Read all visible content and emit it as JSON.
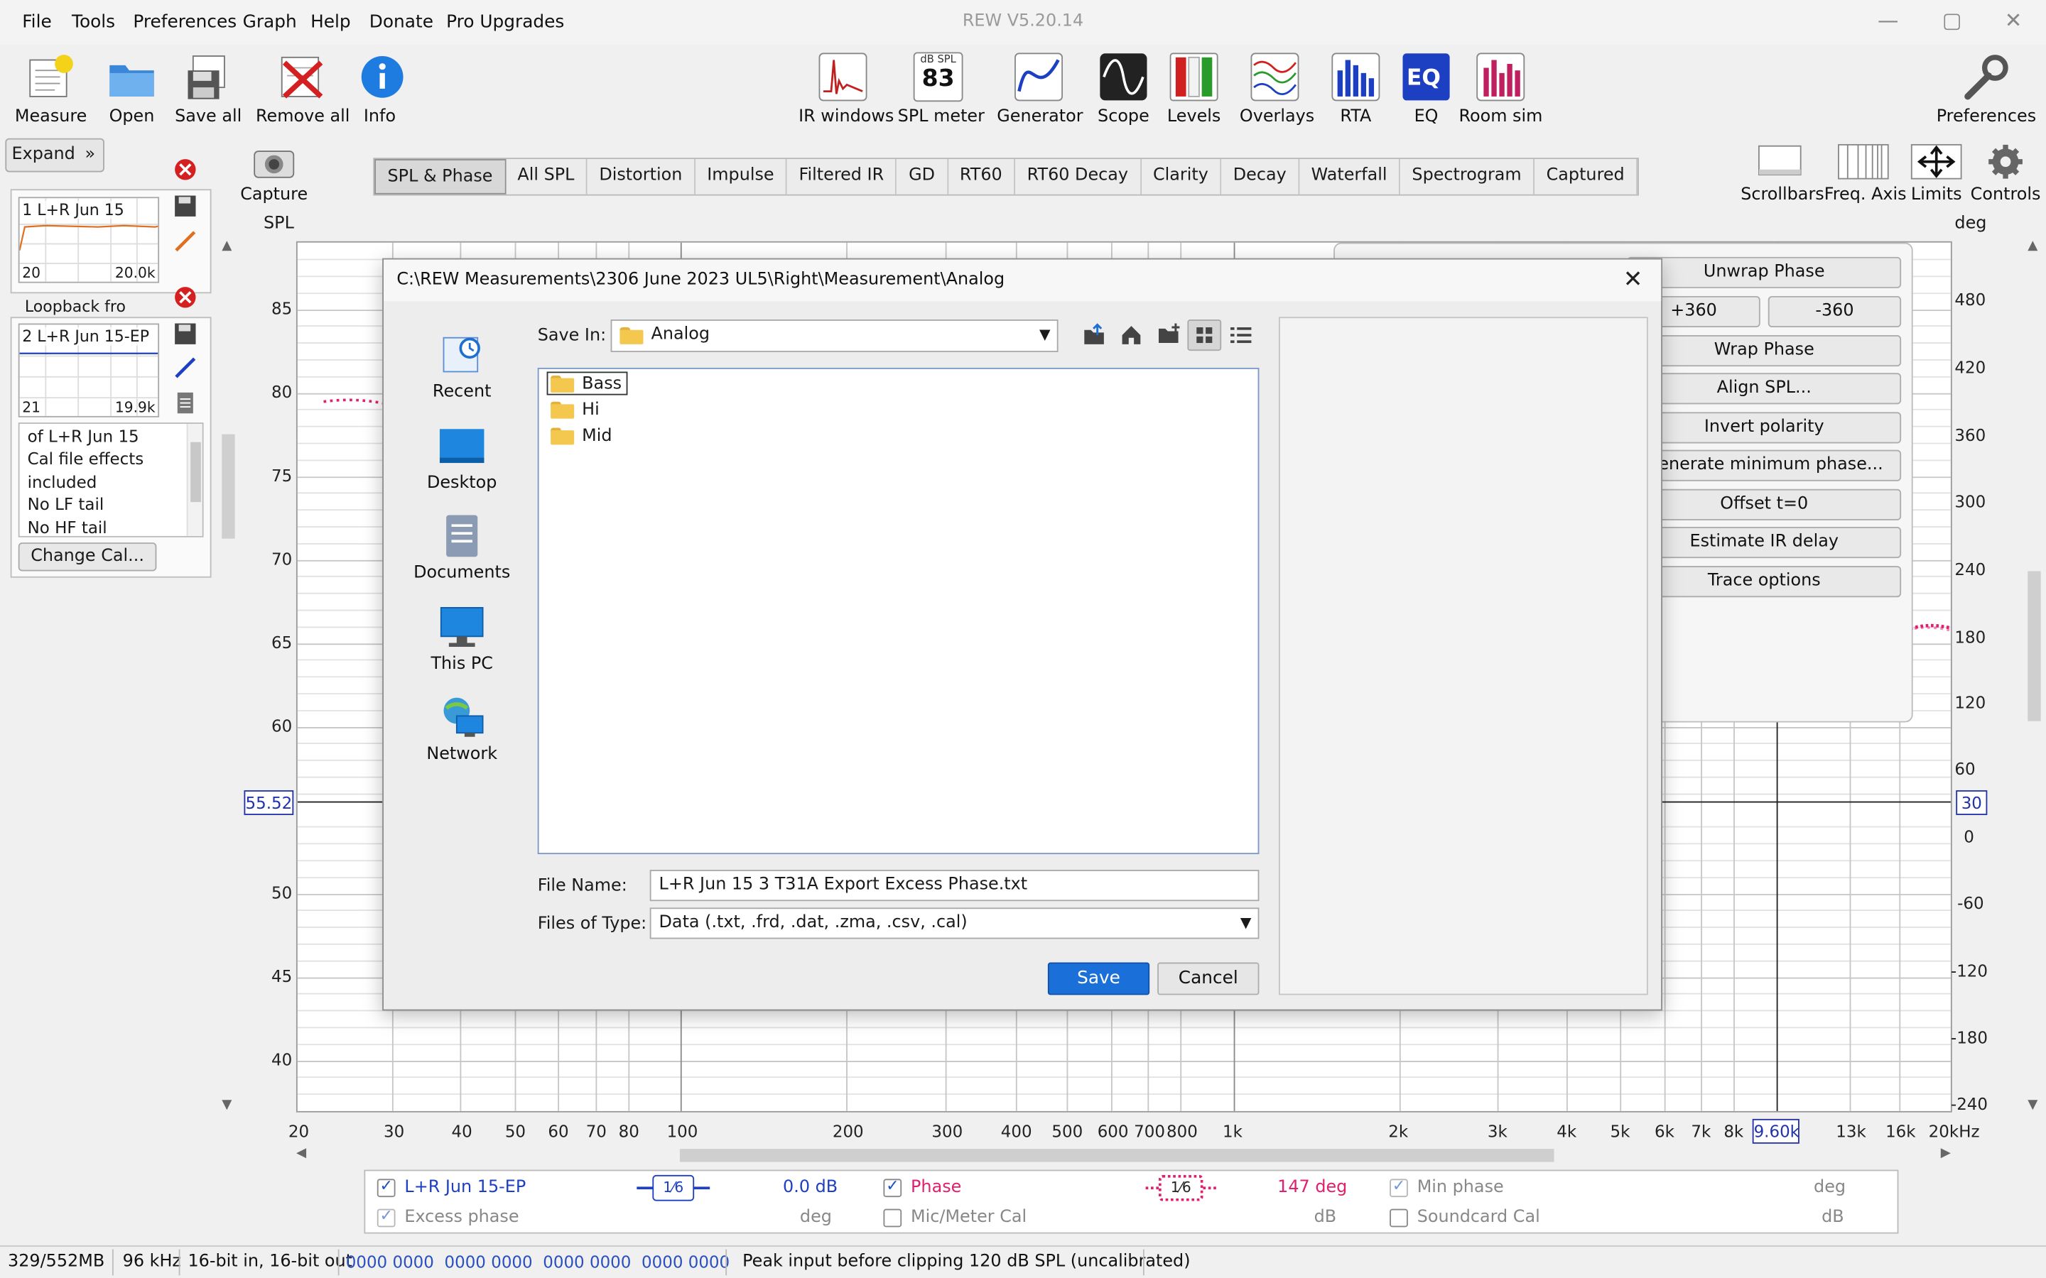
{
  "app": {
    "title": "REW V5.20.14"
  },
  "menu": [
    "File",
    "Tools",
    "Preferences",
    "Graph",
    "Help",
    "Donate",
    "Pro Upgrades"
  ],
  "toolbar_left": [
    "Measure",
    "Open",
    "Save all",
    "Remove all",
    "Info"
  ],
  "toolbar_center": [
    "IR windows",
    "SPL meter",
    "Generator",
    "Scope",
    "Levels",
    "Overlays",
    "RTA",
    "EQ",
    "Room sim"
  ],
  "spl_meter_icon": {
    "top": "dB SPL",
    "value": "83"
  },
  "toolbar_right": {
    "preferences": "Preferences"
  },
  "capture": "Capture",
  "graph_tabs": [
    "SPL & Phase",
    "All SPL",
    "Distortion",
    "Impulse",
    "Filtered IR",
    "GD",
    "RT60",
    "RT60 Decay",
    "Clarity",
    "Decay",
    "Waterfall",
    "Spectrogram",
    "Captured"
  ],
  "active_tab": "SPL & Phase",
  "view_controls": [
    "Scrollbars",
    "Freq. Axis",
    "Limits",
    "Controls"
  ],
  "left_panel": {
    "expand": "Expand",
    "measurements": [
      {
        "label": "1 L+R Jun 15",
        "range_lo": "20",
        "range_hi": "20.0k",
        "name": "Loopback fro"
      },
      {
        "label": "2 L+R Jun 15-EP",
        "range_lo": "21",
        "range_hi": "19.9k"
      }
    ],
    "notes": [
      "of L+R Jun 15",
      "Cal file effects",
      "included",
      "No LF tail",
      "No HF tail"
    ],
    "change_cal": "Change Cal..."
  },
  "graph": {
    "left_axis_title": "SPL",
    "right_axis_title": "deg",
    "y_ticks": [
      "85",
      "80",
      "75",
      "70",
      "65",
      "60",
      "50",
      "45",
      "40"
    ],
    "y_cursor": "55.52",
    "right_ticks": [
      "480",
      "420",
      "360",
      "300",
      "240",
      "180",
      "120",
      "60",
      "0",
      "-60",
      "-120",
      "-180",
      "-240"
    ],
    "right_cursor": "30",
    "x_ticks": [
      "20",
      "30",
      "40",
      "50",
      "60",
      "70",
      "80",
      "100",
      "200",
      "300",
      "400",
      "500",
      "600",
      "700",
      "800",
      "1k",
      "2k",
      "3k",
      "4k",
      "5k",
      "6k",
      "7k",
      "8k",
      "13k",
      "16k",
      "20kHz"
    ],
    "x_cursor": "9.60k",
    "colors": {
      "phase_trace": "#e0206e",
      "cursor": "#2233aa"
    }
  },
  "controls_panel": {
    "buttons": [
      "Unwrap Phase",
      "+360",
      "-360",
      "Wrap Phase",
      "Align SPL...",
      "Invert polarity",
      "Generate minimum phase...",
      "Offset t=0",
      "Estimate IR delay",
      "Trace options"
    ]
  },
  "dialog": {
    "title": "C:\\REW Measurements\\2306 June 2023 UL5\\Right\\Measurement\\Analog",
    "places": [
      "Recent",
      "Desktop",
      "Documents",
      "This PC",
      "Network"
    ],
    "save_in_label": "Save In:",
    "save_in_value": "Analog",
    "files": [
      "Bass",
      "Hi",
      "Mid"
    ],
    "file_name_label": "File Name:",
    "file_name_value": "L+R Jun 15 3 T31A Export Excess Phase.txt",
    "file_type_label": "Files of Type:",
    "file_type_value": "Data (.txt, .frd, .dat, .zma, .csv, .cal)",
    "save": "Save",
    "cancel": "Cancel"
  },
  "legend": {
    "row1": {
      "trace1": "L+R Jun 15-EP",
      "smoothing1": "1⁄6",
      "value1": "0.0 dB",
      "trace2": "Phase",
      "smoothing2": "1⁄6",
      "value2": "147 deg",
      "trace3": "Min phase",
      "unit3": "deg"
    },
    "row2": {
      "trace1": "Excess phase",
      "unit1": "deg",
      "trace2": "Mic/Meter Cal",
      "unit2": "dB",
      "trace3": "Soundcard Cal",
      "unit3": "dB"
    }
  },
  "status": {
    "memory": "329/552MB",
    "rate": "96 kHz",
    "bits": "16-bit in, 16-bit out",
    "levels": "0000 0000  0000 0000  0000 0000  0000 0000",
    "message": "Peak input before clipping 120 dB SPL (uncalibrated)"
  }
}
